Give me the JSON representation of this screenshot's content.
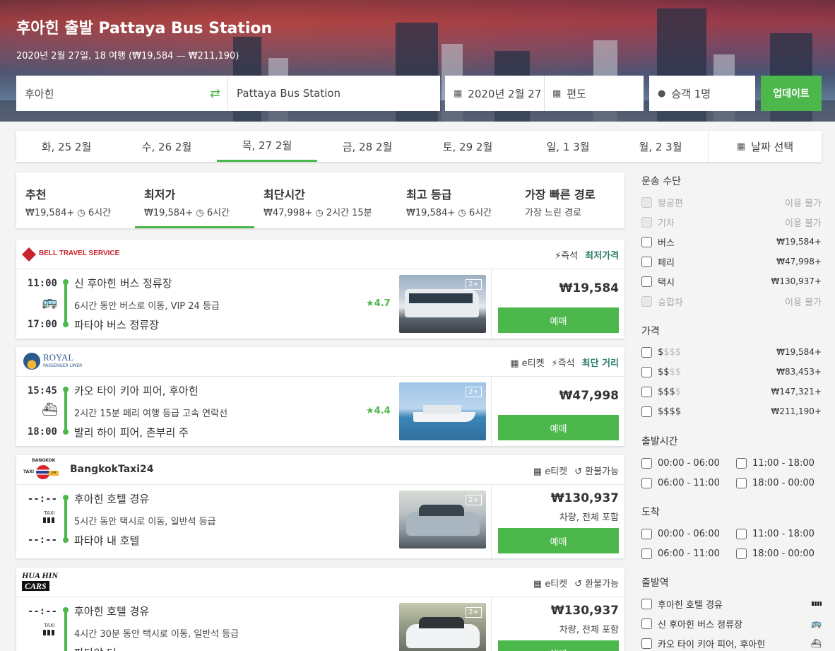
{
  "hero": {
    "title": "후아힌 출발 Pattaya Bus Station",
    "subtitle": "2020년 2월 27일, 18 여행 (₩19,584 — ₩211,190)"
  },
  "search": {
    "from": "후아힌",
    "to": "Pattaya Bus Station",
    "date": "2020년 2월 27",
    "trip_type": "편도",
    "passengers": "승객 1명",
    "update_label": "업데이트"
  },
  "dates": {
    "tabs": [
      "화, 25 2월",
      "수, 26 2월",
      "목, 27 2월",
      "금, 28 2월",
      "토, 29 2월",
      "일, 1 3월",
      "월, 2 3월"
    ],
    "active_index": 2,
    "pick_label": "날짜 선택"
  },
  "sort": [
    {
      "label": "추천",
      "sub": "₩19,584+ ◷ 6시간"
    },
    {
      "label": "최저가",
      "sub": "₩19,584+ ◷ 6시간"
    },
    {
      "label": "최단시간",
      "sub": "₩47,998+ ◷ 2시간 15분"
    },
    {
      "label": "최고 등급",
      "sub": "₩19,584+ ◷ 6시간"
    },
    {
      "label": "가장 빠른 경로",
      "sub": "가장 느린 경로"
    }
  ],
  "results": [
    {
      "operator": "BELL TRAVEL SERVICE",
      "tags": [
        "즉석"
      ],
      "highlight": "최저가격",
      "depart_time": "11:00",
      "arrive_time": "17:00",
      "from_stop": "신 후아힌 버스 정류장",
      "to_stop": "파타야 버스 정류장",
      "desc": "6시간 동안 버스로 이동, VIP 24 등급",
      "rating": "4.7",
      "photo_badge": "2+",
      "price": "₩19,584",
      "price_sub": "",
      "book_label": "예매"
    },
    {
      "operator": "ROYAL",
      "operator_sub": "PASSENGER LINER",
      "tags": [
        "e티켓",
        "즉석"
      ],
      "highlight": "최단 거리",
      "depart_time": "15:45",
      "arrive_time": "18:00",
      "from_stop": "카오 타이 키아 피어, 후아힌",
      "to_stop": "발리 하이 피어, 촌부리 주",
      "desc": "2시간 15분 페리 여행 등급 고속 연락선",
      "rating": "4.4",
      "photo_badge": "2+",
      "price": "₩47,998",
      "price_sub": "",
      "book_label": "예매"
    },
    {
      "operator": "BangkokTaxi24",
      "logo_text_top": "BANGKOK",
      "logo_text_left": "TAXI",
      "logo_text_right": "24",
      "tags": [
        "e티켓",
        "환불가능"
      ],
      "highlight": "",
      "depart_time": "--:--",
      "arrive_time": "--:--",
      "from_stop": "후아힌 호텔 경유",
      "to_stop": "파타야 내 호텔",
      "desc": "5시간 동안 택시로 이동, 일반석 등급",
      "rating": "",
      "photo_badge": "2+",
      "price": "₩130,937",
      "price_sub": "차량, 전체 포함",
      "book_label": "예매"
    },
    {
      "operator": "HUA HIN CARS",
      "logo_line1": "HUA HIN",
      "logo_line2": "CARS",
      "tags": [
        "e티켓",
        "환불가능"
      ],
      "highlight": "",
      "depart_time": "--:--",
      "arrive_time": "",
      "from_stop": "후아힌 호텔 경유",
      "to_stop": "파타야 더 ...",
      "desc": "4시간 30분 동안 택시로 이동, 일반석 등급",
      "rating": "",
      "photo_badge": "2+",
      "price": "₩130,937",
      "price_sub": "차량, 전체 포함",
      "book_label": "예매"
    }
  ],
  "taxi_label": "TAXI",
  "filters": {
    "transport_title": "운송 수단",
    "transport": [
      {
        "label": "항공편",
        "value": "이용 불가",
        "disabled": true
      },
      {
        "label": "기차",
        "value": "이용 불가",
        "disabled": true
      },
      {
        "label": "버스",
        "value": "₩19,584+",
        "disabled": false
      },
      {
        "label": "페리",
        "value": "₩47,998+",
        "disabled": false
      },
      {
        "label": "택시",
        "value": "₩130,937+",
        "disabled": false
      },
      {
        "label": "승합차",
        "value": "이용 불가",
        "disabled": true
      }
    ],
    "price_title": "가격",
    "price": [
      {
        "label_on": "$",
        "label_off": "$$$",
        "value": "₩19,584+"
      },
      {
        "label_on": "$$",
        "label_off": "$$",
        "value": "₩83,453+"
      },
      {
        "label_on": "$$$",
        "label_off": "$",
        "value": "₩147,321+"
      },
      {
        "label_on": "$$$$",
        "label_off": "",
        "value": "₩211,190+"
      }
    ],
    "depart_title": "출발시간",
    "arrive_title": "도착",
    "time_ranges": [
      "00:00 - 06:00",
      "11:00 - 18:00",
      "06:00 - 11:00",
      "18:00 - 00:00"
    ],
    "station_title": "출발역",
    "stations": [
      "후아힌 호텔 경유",
      "신 후아힌 버스 정류장",
      "카오 타이 키아 피어, 후아힌"
    ]
  },
  "colors": {
    "accent": "#4cb84c",
    "highlight_text": "#2a7a6a"
  }
}
